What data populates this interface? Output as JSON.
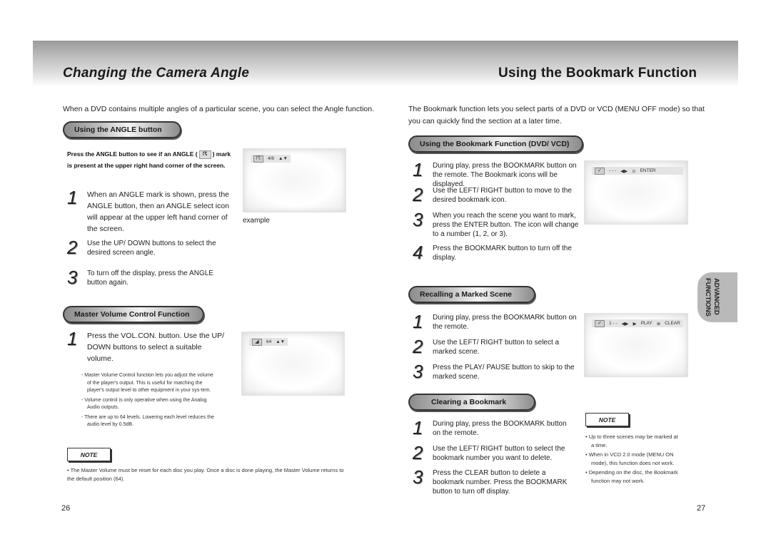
{
  "left_page": {
    "title": "Changing the Camera Angle",
    "intro": "When a DVD contains multiple angles of a particular scene, you can select the Angle function.",
    "angle_section": {
      "heading": "Using the ANGLE button",
      "note_part1": "Press the ANGLE button to see if an ANGLE (",
      "note_icon": "angle-icon",
      "note_part2": ") mark is present at the upper right hand corner of the screen.",
      "steps": [
        {
          "num": "1",
          "text": "When an ANGLE mark is shown, press the ANGLE button, then an ANGLE select icon will appear at the upper left hand corner of the screen."
        },
        {
          "num": "2",
          "text": "Use the UP/ DOWN buttons to select the desired screen angle."
        },
        {
          "num": "3",
          "text": "To turn off the display, press the ANGLE button again."
        }
      ],
      "screen": {
        "osd_icon": "angle-icon",
        "osd_value": "4/6",
        "osd_arrows": "▲▼"
      },
      "caption": "example"
    },
    "volume_section": {
      "heading": "Master Volume Control Function",
      "steps": [
        {
          "num": "1",
          "text": "Press the VOL.CON. button. Use the UP/ DOWN buttons to select a suitable volume."
        }
      ],
      "screen": {
        "osd_icon": "volume-icon",
        "osd_value": "64",
        "osd_arrows": "▲▼"
      },
      "bullets": [
        "- Master Volume Control function lets you adjust the volume of the player's output. This is useful for matching the player's output level to other equipment in your sys-tem.",
        "- Volume control is only operative when using the Analog Audio outputs.",
        "- There are up to 64 levels. Lowering each level reduces the audio level by 0.5dB."
      ]
    },
    "note": {
      "label": "NOTE",
      "text": "• The Master Volume must be reset for each disc you play. Once a disc is done playing, the Master Volume returns to the default position (64)."
    },
    "page_number": "26"
  },
  "right_page": {
    "title": "Using the Bookmark Function",
    "intro": "The Bookmark function lets you select parts of a DVD or VCD (MENU OFF mode) so that you can quickly find the section at a later time.",
    "bookmark_section": {
      "heading": "Using the Bookmark Function (DVD/ VCD)",
      "steps": [
        {
          "num": "1",
          "text": "During play, press the BOOKMARK button on the remote. The Bookmark icons will be displayed."
        },
        {
          "num": "2",
          "text": "Use the LEFT/ RIGHT button to move to the desired bookmark icon."
        },
        {
          "num": "3",
          "text": "When you reach the scene you want to mark, press the ENTER button. The icon will change to a number (1, 2, or 3)."
        },
        {
          "num": "4",
          "text": "Press the BOOKMARK button to turn off the display."
        }
      ],
      "screen": {
        "osd_icon": "bookmark-icon",
        "slots": "- - -",
        "nav": "◀▶",
        "enter_icon": "enter-icon",
        "enter_label": "ENTER"
      }
    },
    "recall_section": {
      "heading": "Recalling a Marked Scene",
      "steps": [
        {
          "num": "1",
          "text": "During play, press the BOOKMARK button on the remote."
        },
        {
          "num": "2",
          "text": "Use the LEFT/ RIGHT button to select a marked scene."
        },
        {
          "num": "3",
          "text": "Press the PLAY/ PAUSE button to skip to the marked scene."
        }
      ],
      "screen": {
        "osd_icon": "bookmark-icon",
        "slots": "1 - -",
        "nav": "◀▶",
        "play_label": "PLAY",
        "clear_label": "CLEAR"
      }
    },
    "clear_section": {
      "heading": "Clearing a Bookmark",
      "steps": [
        {
          "num": "1",
          "text": "During play, press the BOOKMARK button on the remote."
        },
        {
          "num": "2",
          "text": "Use the LEFT/ RIGHT button to select the bookmark number you want to delete."
        },
        {
          "num": "3",
          "text": "Press the CLEAR button to delete a bookmark number. Press the BOOKMARK button to turn off display."
        }
      ]
    },
    "note": {
      "label": "NOTE",
      "items": [
        "• Up to three scenes may be marked at a time.",
        "• When in VCD 2.0 mode (MENU ON mode), this function does not work.",
        "• Depending on the disc, the Bookmark function may not work."
      ]
    },
    "side_tab": {
      "line1": "ADVANCED",
      "line2": "FUNCTIONS"
    },
    "page_number": "27"
  }
}
